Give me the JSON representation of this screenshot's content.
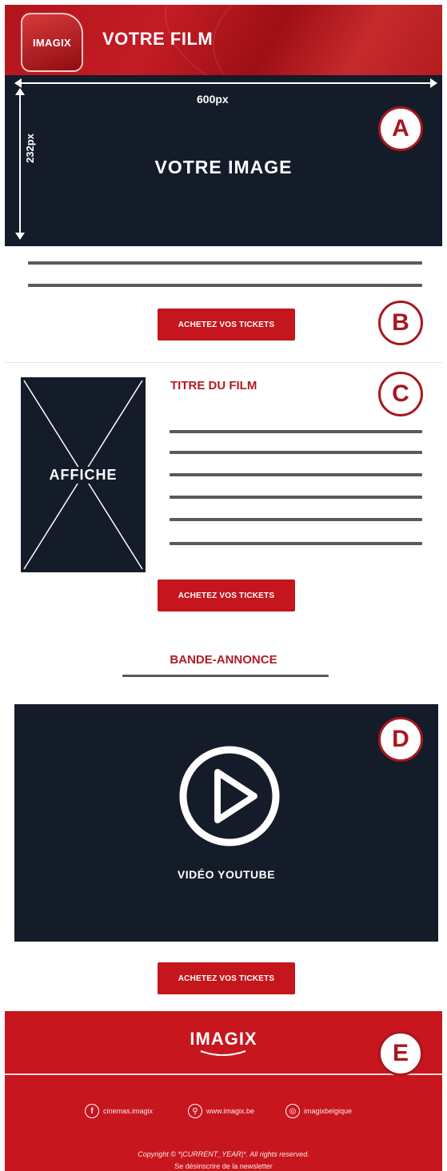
{
  "header": {
    "logo_text": "IMAGIX",
    "title": "VOTRE FILM"
  },
  "section_a": {
    "badge": "A",
    "width_label": "600px",
    "height_label": "232px",
    "title": "VOTRE IMAGE"
  },
  "section_b": {
    "badge": "B",
    "button_label": "ACHETEZ VOS TICKETS"
  },
  "section_c": {
    "badge": "C",
    "poster_label": "AFFICHE",
    "movie_title": "TITRE DU FILM",
    "button_label": "ACHETEZ VOS TICKETS"
  },
  "trailer": {
    "heading": "BANDE-ANNONCE"
  },
  "section_d": {
    "badge": "D",
    "video_label": "VIDÉO YOUTUBE",
    "button_label": "ACHETEZ VOS TICKETS"
  },
  "footer": {
    "badge": "E",
    "logo_text": "IMAGIX",
    "social": [
      {
        "icon": "facebook-icon",
        "glyph": "f",
        "label": "cinemas.imagix"
      },
      {
        "icon": "link-icon",
        "glyph": "⚲",
        "label": "www.imagix.be"
      },
      {
        "icon": "instagram-icon",
        "glyph": "◎",
        "label": "imagixbelgique"
      }
    ],
    "copyright": "Copyright © *|CURRENT_YEAR|*. All rights reserved.",
    "unsubscribe": "Se désinscrire de la newsletter"
  },
  "colors": {
    "brand_red": "#c4161c",
    "dark_navy": "#141c2a",
    "text_red": "#b01c24",
    "badge_red": "#a8171f"
  }
}
